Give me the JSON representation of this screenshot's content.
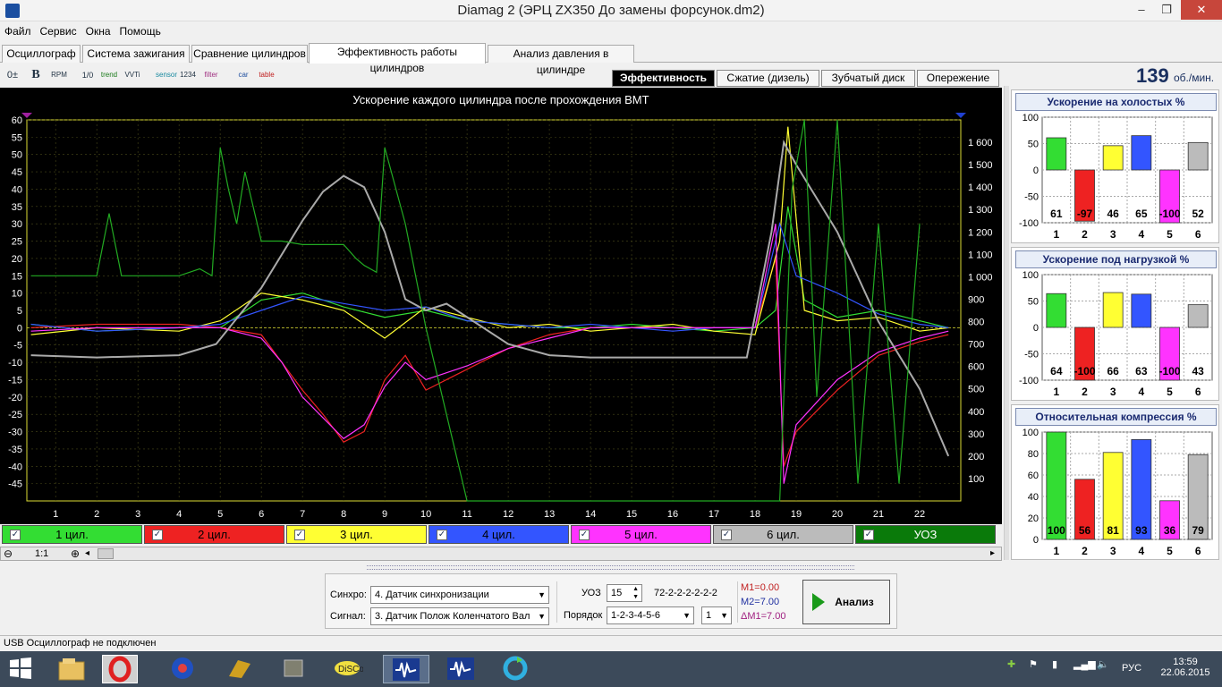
{
  "window": {
    "title": "Diamag 2 (ЭРЦ ZX350 До замены форсунок.dm2)",
    "minimize": "–",
    "restore": "❐",
    "close": "✕"
  },
  "menu": [
    "Файл",
    "Сервис",
    "Окна",
    "Помощь"
  ],
  "tabs": [
    "Осциллограф",
    "Система зажигания",
    "Сравнение цилиндров",
    "Эффективность работы цилиндров",
    "Анализ давления в цилиндре"
  ],
  "toolbar_icons": [
    "0±",
    "B",
    "RPM",
    "1/0",
    "trend",
    "VVTi",
    "sensor",
    "1234",
    "filter",
    "car",
    "table"
  ],
  "subtabs": [
    "Эффективность",
    "Сжатие (дизель)",
    "Зубчатый диск",
    "Опережение"
  ],
  "rpm": {
    "value": "139",
    "unit": "об./мин."
  },
  "chart_data": {
    "type": "line",
    "title": "Ускорение каждого цилиндра после прохождения ВМТ",
    "x_ticks": [
      "1",
      "2",
      "3",
      "4",
      "5",
      "6",
      "7",
      "8",
      "9",
      "10",
      "11",
      "12",
      "13",
      "14",
      "15",
      "16",
      "17",
      "18",
      "19",
      "20",
      "21",
      "22"
    ],
    "y_left_ticks": [
      "60",
      "55",
      "50",
      "45",
      "40",
      "35",
      "30",
      "25",
      "20",
      "15",
      "10",
      "5",
      "0",
      "-5",
      "-10",
      "-15",
      "-20",
      "-25",
      "-30",
      "-35",
      "-40",
      "-45"
    ],
    "y_right_ticks": [
      "1 600",
      "1 500",
      "1 400",
      "1 300",
      "1 200",
      "1 100",
      "1 000",
      "900",
      "800",
      "700",
      "600",
      "500",
      "400",
      "300",
      "200",
      "100"
    ],
    "ylim_left": [
      -50,
      60
    ],
    "ylim_right": [
      0,
      1700
    ],
    "xlim": [
      0.3,
      23
    ],
    "series": [
      {
        "name": "1 цил.",
        "color": "#33dd33",
        "x": [
          0.4,
          2,
          4,
          5,
          6,
          7,
          8,
          9,
          10,
          11,
          12,
          13,
          14,
          15,
          16,
          17,
          18,
          18.5,
          18.8,
          19.2,
          20,
          21,
          22,
          22.7
        ],
        "y": [
          1,
          -1,
          0,
          0,
          8,
          10,
          6,
          3,
          5,
          2,
          1,
          0,
          0,
          1,
          0,
          -1,
          0,
          5,
          35,
          8,
          3,
          5,
          2,
          0
        ]
      },
      {
        "name": "2 цил.",
        "color": "#ee2222",
        "x": [
          0.4,
          2,
          4,
          5,
          6,
          6.5,
          7,
          7.5,
          8,
          8.5,
          9,
          9.5,
          10,
          11,
          12,
          13,
          14,
          15,
          16,
          17,
          18,
          18.5,
          18.7,
          19,
          20,
          21,
          22,
          22.7
        ],
        "y": [
          0,
          1,
          1,
          0,
          -2,
          -10,
          -18,
          -25,
          -33,
          -30,
          -15,
          -8,
          -18,
          -12,
          -6,
          -2,
          0,
          0,
          0,
          0,
          0,
          20,
          -40,
          -30,
          -18,
          -8,
          -4,
          -2
        ]
      },
      {
        "name": "3 цил.",
        "color": "#ffff33",
        "x": [
          0.4,
          2,
          4,
          5,
          6,
          7,
          8,
          9,
          10,
          11,
          12,
          13,
          14,
          15,
          16,
          17,
          18,
          18.6,
          18.8,
          19.2,
          20,
          21,
          22,
          22.7
        ],
        "y": [
          -2,
          0,
          -1,
          2,
          10,
          8,
          5,
          -3,
          6,
          3,
          0,
          1,
          -1,
          0,
          1,
          -1,
          -2,
          25,
          58,
          5,
          2,
          3,
          -1,
          0
        ]
      },
      {
        "name": "4 цил.",
        "color": "#3355ff",
        "x": [
          0.4,
          2,
          4,
          5,
          6,
          7,
          8,
          9,
          10,
          11,
          12,
          13,
          14,
          15,
          16,
          17,
          18,
          18.6,
          19,
          20,
          21,
          22,
          22.7
        ],
        "y": [
          1,
          -1,
          0,
          1,
          5,
          9,
          7,
          5,
          6,
          2,
          1,
          0,
          1,
          0,
          -1,
          0,
          0,
          30,
          15,
          10,
          4,
          1,
          0
        ]
      },
      {
        "name": "5 цил.",
        "color": "#ff33ff",
        "x": [
          0.4,
          2,
          4,
          5,
          6,
          6.5,
          7,
          7.5,
          8,
          8.5,
          9,
          9.5,
          10,
          11,
          12,
          13,
          14,
          15,
          16,
          17,
          18,
          18.5,
          18.7,
          19,
          20,
          21,
          22,
          22.7
        ],
        "y": [
          -1,
          0,
          0,
          0,
          -3,
          -10,
          -20,
          -26,
          -32,
          -28,
          -17,
          -10,
          -15,
          -11,
          -6,
          -3,
          0,
          0,
          0,
          0,
          0,
          30,
          -45,
          -28,
          -15,
          -7,
          -3,
          -1
        ]
      },
      {
        "name": "6 цил.",
        "color": "#aaaaaa",
        "x": [
          0.4,
          2,
          4,
          4.9,
          6,
          7,
          7.5,
          8,
          8.5,
          9,
          9.5,
          10,
          10.5,
          11,
          12,
          13,
          14,
          15,
          16,
          17,
          17.8,
          18.4,
          18.7,
          19,
          20,
          21,
          22,
          22.7
        ],
        "y": [
          650,
          640,
          650,
          700,
          950,
          1250,
          1380,
          1450,
          1400,
          1200,
          900,
          850,
          880,
          820,
          700,
          650,
          640,
          640,
          640,
          640,
          640,
          1200,
          1600,
          1500,
          1200,
          800,
          500,
          200
        ]
      },
      {
        "name": "УОЗ",
        "color": "#22aa22",
        "x": [
          0.4,
          2,
          2.3,
          2.6,
          3,
          4,
          4.5,
          4.8,
          5,
          5.2,
          5.4,
          5.6,
          6,
          6.5,
          7,
          7.5,
          8,
          8.3,
          8.5,
          8.8,
          9,
          9.5,
          10,
          11,
          12,
          18.6,
          18.9,
          19.2,
          19.5,
          20,
          20.5,
          21,
          21.5,
          22
        ],
        "y": [
          15,
          15,
          33,
          15,
          15,
          15,
          17,
          15,
          52,
          40,
          30,
          45,
          25,
          25,
          24,
          24,
          24,
          20,
          18,
          16,
          52,
          30,
          0,
          -50,
          -50,
          -50,
          40,
          60,
          -20,
          60,
          -45,
          30,
          -45,
          30
        ]
      }
    ]
  },
  "legend": [
    {
      "label": "1 цил.",
      "bg": "#33dd33",
      "color": "#000"
    },
    {
      "label": "2 цил.",
      "bg": "#ee2222",
      "color": "#000"
    },
    {
      "label": "3 цил.",
      "bg": "#ffff33",
      "color": "#000"
    },
    {
      "label": "4 цил.",
      "bg": "#3355ff",
      "color": "#000"
    },
    {
      "label": "5 цил.",
      "bg": "#ff33ff",
      "color": "#000"
    },
    {
      "label": "6 цил.",
      "bg": "#bbbbbb",
      "color": "#000"
    },
    {
      "label": "УОЗ",
      "bg": "#0a7a0a",
      "color": "#fff"
    }
  ],
  "zoom": {
    "label": "1:1"
  },
  "bar_panels": [
    {
      "title": "Ускорение на холостых %",
      "ylim": [
        -100,
        100
      ],
      "ticks": [
        "100",
        "50",
        "0",
        "-50",
        "-100"
      ],
      "values": [
        61,
        -97,
        46,
        65,
        -100,
        52
      ],
      "categories": [
        "1",
        "2",
        "3",
        "4",
        "5",
        "6"
      ]
    },
    {
      "title": "Ускорение под нагрузкой %",
      "ylim": [
        -100,
        100
      ],
      "ticks": [
        "100",
        "50",
        "0",
        "-50",
        "-100"
      ],
      "values": [
        64,
        -100,
        66,
        63,
        -100,
        43
      ],
      "categories": [
        "1",
        "2",
        "3",
        "4",
        "5",
        "6"
      ]
    },
    {
      "title": "Относительная компрессия %",
      "ylim": [
        0,
        100
      ],
      "ticks": [
        "100",
        "80",
        "60",
        "40",
        "20",
        "0"
      ],
      "values": [
        100,
        56,
        81,
        93,
        36,
        79
      ],
      "categories": [
        "1",
        "2",
        "3",
        "4",
        "5",
        "6"
      ]
    }
  ],
  "bar_colors": [
    "#33dd33",
    "#ee2222",
    "#ffff33",
    "#3355ff",
    "#ff33ff",
    "#bbbbbb"
  ],
  "controls": {
    "sync_label": "Синхро:",
    "sync_value": "4.  Датчик синхронизации",
    "signal_label": "Сигнал:",
    "signal_value": "3.  Датчик Полож Коленчатого Вал",
    "uoz_label": "УОЗ",
    "uoz_value": "15",
    "disk_pattern": "72-2-2-2-2-2-2",
    "order_label": "Порядок",
    "order_value": "1-2-3-4-5-6",
    "order_num": "1",
    "m1": "M1=0.00",
    "m2": "M2=7.00",
    "dm1": "ΔM1=7.00",
    "analyze_button": "Анализ"
  },
  "status": "USB Осциллограф не подключен",
  "tray": {
    "lang": "РУС",
    "time": "13:59",
    "date": "22.06.2015"
  }
}
